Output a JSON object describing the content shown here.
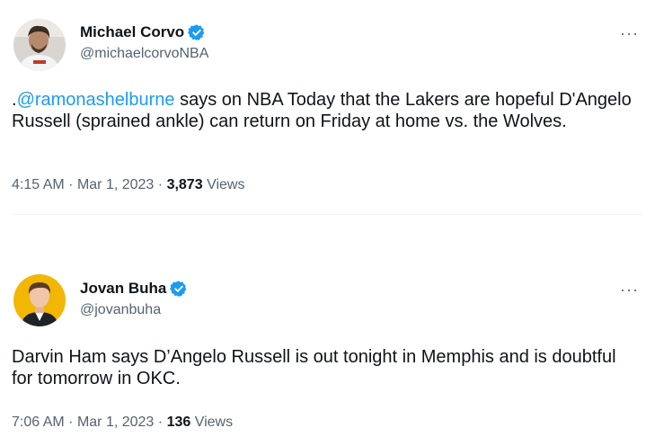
{
  "colors": {
    "text": "#0f1419",
    "secondary": "#536471",
    "link": "#1d9bf0",
    "verified": "#1d9bf0"
  },
  "tweets": [
    {
      "author": {
        "name": "Michael Corvo",
        "handle": "@michaelcorvoNBA",
        "verified": true,
        "avatar_icon": "avatar-photo-icon"
      },
      "more_icon": "···",
      "body_prefix": ".",
      "mention": "@ramonashelburne",
      "body_rest": " says on NBA Today that the Lakers are hopeful D'Angelo Russell (sprained ankle) can return on Friday at home vs. the Wolves.",
      "time": "4:15 AM",
      "date": "Mar 1, 2023",
      "views_count": "3,873",
      "views_label": "Views"
    },
    {
      "author": {
        "name": "Jovan Buha",
        "handle": "@jovanbuha",
        "verified": true,
        "avatar_icon": "avatar-photo-icon"
      },
      "more_icon": "···",
      "body": "Darvin Ham says D’Angelo Russell is out tonight in Memphis and is doubtful for tomorrow in OKC.",
      "time": "7:06 AM",
      "date": "Mar 1, 2023",
      "views_count": "136",
      "views_label": "Views"
    }
  ]
}
